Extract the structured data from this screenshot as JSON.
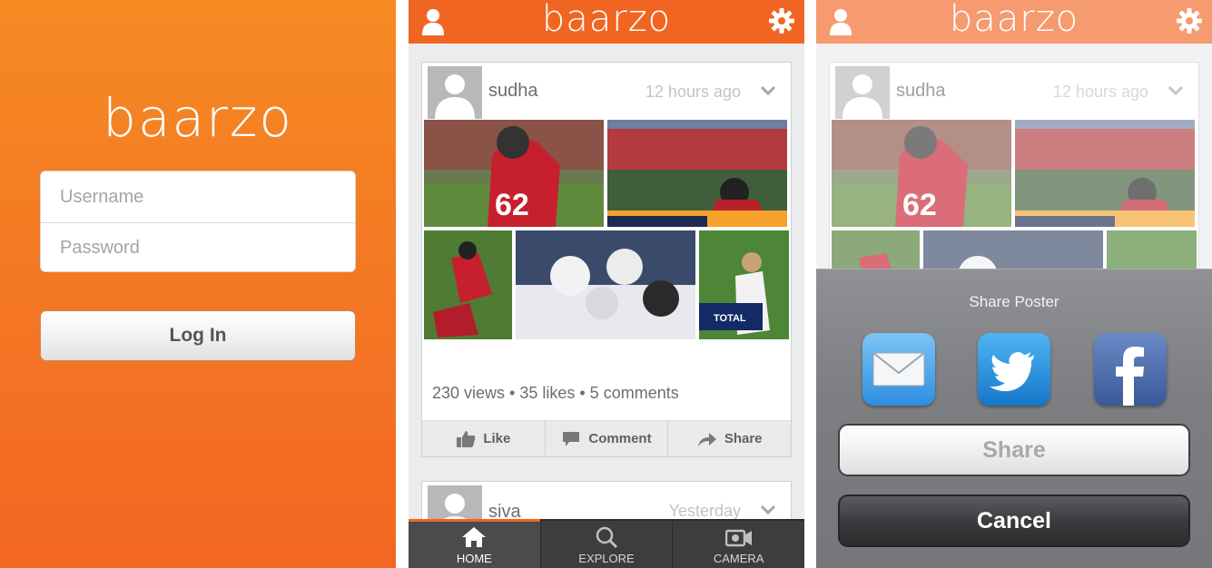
{
  "login": {
    "logo": "baarzo",
    "username_placeholder": "Username",
    "password_placeholder": "Password",
    "login_label": "Log In"
  },
  "app": {
    "brand": "baarzo",
    "accent": "#f16522"
  },
  "feed": {
    "posts": [
      {
        "user": "sudha",
        "time": "12 hours ago",
        "stats": "230 views • 35 likes • 5 comments"
      },
      {
        "user": "siva",
        "time": "Yesterday"
      }
    ],
    "actions": {
      "like": "Like",
      "comment": "Comment",
      "share": "Share"
    }
  },
  "tabs": [
    {
      "label": "HOME",
      "icon": "home-icon",
      "active": true
    },
    {
      "label": "EXPLORE",
      "icon": "search-icon",
      "active": false
    },
    {
      "label": "CAMERA",
      "icon": "camera-icon",
      "active": false
    }
  ],
  "share_sheet": {
    "title": "Share Poster",
    "targets": [
      "mail-icon",
      "twitter-icon",
      "facebook-icon"
    ],
    "share_label": "Share",
    "cancel_label": "Cancel"
  }
}
